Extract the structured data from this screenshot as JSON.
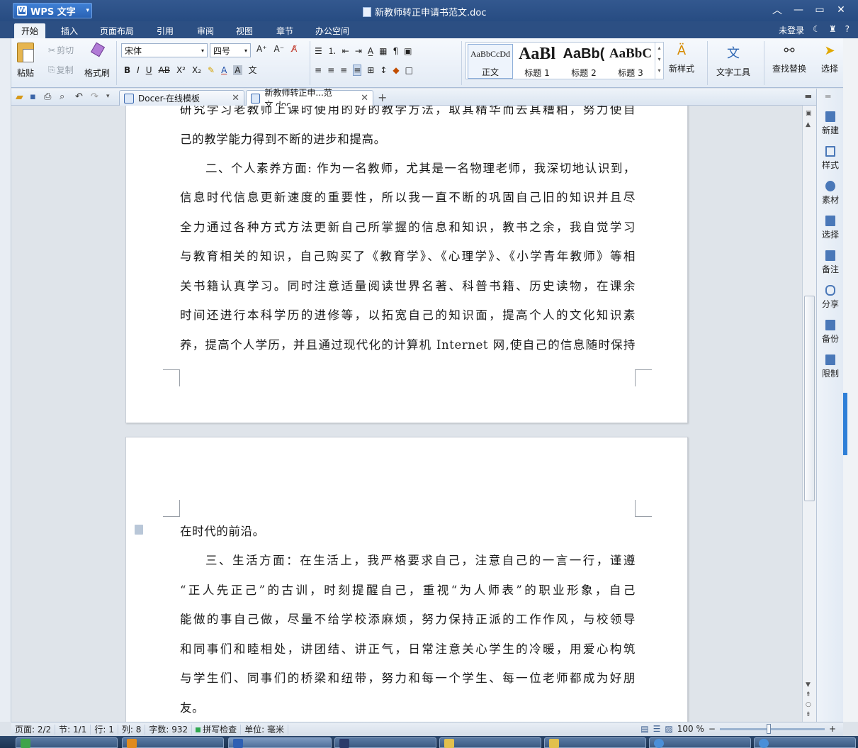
{
  "window": {
    "app_name": "WPS 文字",
    "doc_title": "新教师转正申请书范文.doc",
    "login": "未登录",
    "help": "?"
  },
  "menu_tabs": [
    "开始",
    "插入",
    "页面布局",
    "引用",
    "审阅",
    "视图",
    "章节",
    "办公空间"
  ],
  "ribbon": {
    "paste": "粘贴",
    "cut": "剪切",
    "copy": "复制",
    "format_painter": "格式刷",
    "font_name": "宋体",
    "font_size": "四号",
    "styles": [
      {
        "preview": "AaBbCcDd",
        "name": "正文"
      },
      {
        "preview": "AaBl",
        "name": "标题 1"
      },
      {
        "preview": "AaBb(",
        "name": "标题 2"
      },
      {
        "preview": "AaBbC",
        "name": "标题 3"
      }
    ],
    "new_style": "新样式",
    "text_tools": "文字工具",
    "find_replace": "查找替换",
    "select": "选择"
  },
  "doc_tabs": [
    {
      "label": "Docer-在线模板",
      "active": false
    },
    {
      "label": "新教师转正申...范文.doc",
      "active": true
    }
  ],
  "page1_lines": [
    "研究学习老教师上课时使用的好的教学方法，取其精华而去其糟粕，努力使自",
    "己的教学能力得到不断的进步和提高。",
    "二、个人素养方面: 作为一名教师，尤其是一名物理老师，我深切地认识到，",
    "信息时代信息更新速度的重要性，所以我一直不断的巩固自己旧的知识并且尽",
    "全力通过各种方式方法更新自己所掌握的信息和知识，教书之余，我自觉学习",
    "与教育相关的知识，自己购买了《教育学》、《心理学》、《小学青年教师》等相",
    "关书籍认真学习。同时注意适量阅读世界名著、科普书籍、历史读物，在课余",
    "时间还进行本科学历的进修等，以拓宽自己的知识面，提高个人的文化知识素",
    "养，提高个人学历，并且通过现代化的计算机 Internet 网,使自己的信息随时保持"
  ],
  "page2_lines": [
    "在时代的前沿。",
    "三、生活方面：在生活上，我严格要求自己，注意自己的一言一行，谨遵",
    "“正人先正己”的古训，时刻提醒自己，重视“为人师表”的职业形象，自己",
    "能做的事自己做，尽量不给学校添麻烦，努力保持正派的工作作风，与校领导",
    "和同事们和睦相处，讲团结、讲正气，日常注意关心学生的冷暖，用爱心构筑",
    "与学生们、同事们的桥梁和纽带，努力和每一个学生、每一位老师都成为好朋",
    "友。"
  ],
  "task_pane": [
    "新建",
    "样式",
    "素材",
    "选择",
    "备注",
    "分享",
    "备份",
    "限制"
  ],
  "status": {
    "page": "页面: 2/2",
    "section": "节: 1/1",
    "row": "行: 1",
    "col": "列: 8",
    "words": "字数: 932",
    "spell": "拼写检查",
    "unit": "单位: 毫米",
    "zoom": "100 %"
  },
  "colors": {
    "titlebar": "#2c4f83",
    "accent": "#2e7fd7"
  }
}
